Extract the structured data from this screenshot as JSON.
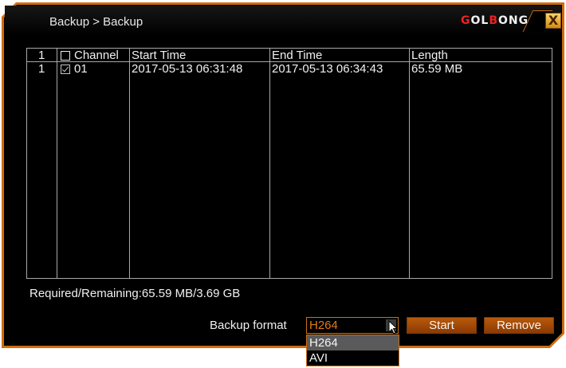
{
  "title": "Backup > Backup",
  "logo": {
    "p1": "G",
    "p2": "OL",
    "p3": "B",
    "p4": "ONG"
  },
  "close_glyph": "X",
  "table": {
    "headers": {
      "index": "1",
      "channel": "Channel",
      "start": "Start Time",
      "end": "End Time",
      "length": "Length"
    },
    "rows": [
      {
        "index": "1",
        "checked": true,
        "channel": "01",
        "start": "2017-05-13 06:31:48",
        "end": "2017-05-13 06:34:43",
        "length": "65.59 MB"
      }
    ]
  },
  "status": "Required/Remaining:65.59 MB/3.69 GB",
  "format": {
    "label": "Backup format",
    "value": "H264",
    "options": [
      "H264",
      "AVI"
    ],
    "highlighted": "H264"
  },
  "buttons": {
    "start": "Start",
    "remove": "Remove"
  },
  "colors": {
    "accent": "#cf6d0f",
    "background": "#000000",
    "text": "#f0f0f0"
  }
}
